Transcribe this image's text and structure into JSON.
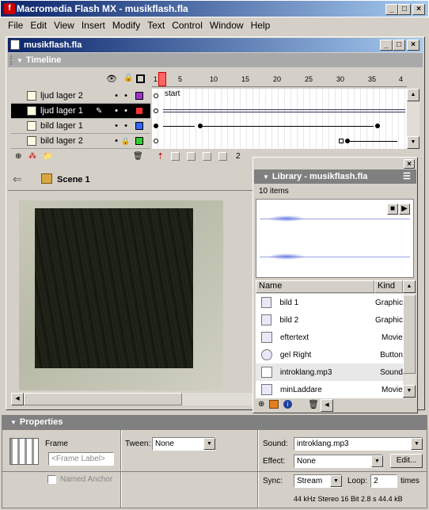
{
  "app": {
    "title": "Macromedia Flash MX - musikflash.fla"
  },
  "menu": [
    "File",
    "Edit",
    "View",
    "Insert",
    "Modify",
    "Text",
    "Control",
    "Window",
    "Help"
  ],
  "doc": {
    "title": "musikflash.fla"
  },
  "timeline": {
    "title": "Timeline",
    "frame_numbers": [
      "1",
      "5",
      "10",
      "15",
      "20",
      "25",
      "30",
      "35",
      "4"
    ],
    "label_start": "start",
    "layers": [
      {
        "name": "ljud lager 2",
        "color": "#9933cc",
        "selected": false,
        "locked": false
      },
      {
        "name": "ljud lager 1",
        "color": "#ff3333",
        "selected": true,
        "locked": false
      },
      {
        "name": "bild lager 1",
        "color": "#3366ff",
        "selected": false,
        "locked": false
      },
      {
        "name": "bild lager 2",
        "color": "#33cc33",
        "selected": false,
        "locked": true
      }
    ],
    "current_frame": "2"
  },
  "scene": {
    "name": "Scene 1"
  },
  "library": {
    "title": "Library - musikflash.fla",
    "count": "10 items",
    "col_name": "Name",
    "col_kind": "Kind",
    "items": [
      {
        "name": "bild 1",
        "kind": "Graphic",
        "icon": "graphic-icon"
      },
      {
        "name": "bild 2",
        "kind": "Graphic",
        "icon": "graphic-icon"
      },
      {
        "name": "eftertext",
        "kind": "Movie",
        "icon": "movie-clip-icon"
      },
      {
        "name": "gel Right",
        "kind": "Button",
        "icon": "button-icon"
      },
      {
        "name": "introklang.mp3",
        "kind": "Sound",
        "icon": "sound-icon",
        "selected": true
      },
      {
        "name": "minLaddare",
        "kind": "Movie",
        "icon": "movie-clip-icon"
      }
    ]
  },
  "properties": {
    "title": "Properties",
    "frame_label": "Frame",
    "frame_placeholder": "<Frame Label>",
    "named_anchor": "Named Anchor",
    "tween_label": "Tween:",
    "tween_value": "None",
    "sound_label": "Sound:",
    "sound_value": "introklang.mp3",
    "effect_label": "Effect:",
    "effect_value": "None",
    "edit_label": "Edit...",
    "sync_label": "Sync:",
    "sync_value": "Stream",
    "loop_label": "Loop:",
    "loop_value": "2",
    "loop_unit": "times",
    "sound_info": "44 kHz Stereo 16 Bit 2.8 s 44.4 kB"
  }
}
